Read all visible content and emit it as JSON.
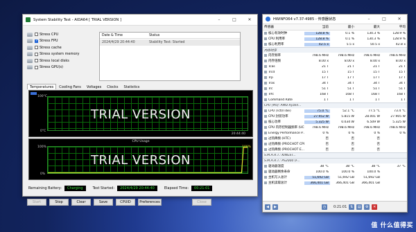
{
  "aida": {
    "title": "System Stability Test - AIDA64  [ TRIAL VERSION ]",
    "stress_options": [
      {
        "label": "Stress CPU",
        "checked": false
      },
      {
        "label": "Stress FPU",
        "checked": true
      },
      {
        "label": "Stress cache",
        "checked": false
      },
      {
        "label": "Stress system memory",
        "checked": false
      },
      {
        "label": "Stress local disks",
        "checked": false
      },
      {
        "label": "Stress GPU(s)",
        "checked": false
      }
    ],
    "log_headers": {
      "date": "Date & Time",
      "status": "Status"
    },
    "log_rows": [
      {
        "date": "2024/4/29 20:44:40",
        "status": "Stability Test: Started"
      }
    ],
    "tabs": [
      "Temperatures",
      "Cooling Fans",
      "Voltages",
      "Clocks",
      "Statistics"
    ],
    "graph1": {
      "top_label": "100°C",
      "bottom_label": "0°C",
      "time_label": "20:44:40",
      "watermark": "TRIAL VERSION"
    },
    "graph2": {
      "title": "CPU Usage",
      "top_label": "100%",
      "bottom_label": "0%",
      "right_label": "100%",
      "watermark": "TRIAL VERSION"
    },
    "status": {
      "battery_label": "Remaining Battery:",
      "battery_value": "Charging",
      "started_label": "Test Started:",
      "started_value": "2024/4/29 20:44:40",
      "elapsed_label": "Elapsed Time:",
      "elapsed_value": "00:21:01"
    },
    "buttons": {
      "start": "Start",
      "stop": "Stop",
      "clear": "Clear",
      "save": "Save",
      "cpuid": "CPUID",
      "preferences": "Preferences",
      "close": "Close"
    }
  },
  "hw": {
    "title": "HWiNFO64 v7.37-4985 - 传感器状态",
    "headers": {
      "sensor": "传感器",
      "current": "当前",
      "min": "最小",
      "max": "最大",
      "avg": "平均"
    },
    "rows": [
      {
        "type": "row",
        "n": "核心有效时钟",
        "c": "128.8 %",
        "mi": "0.1 %",
        "ma": "130.3 %",
        "av": "128.9 %",
        "hl": true
      },
      {
        "type": "row",
        "n": "CPU 利用率",
        "c": "128.8 %",
        "mi": "0.1 %",
        "ma": "130.3 %",
        "av": "128.9 %",
        "hl": true
      },
      {
        "type": "row",
        "n": "核心利用率",
        "c": "42.5 x",
        "mi": "5.5 x",
        "ma": "50.5 x",
        "av": "42.8 x",
        "hl": true
      },
      {
        "type": "group",
        "n": "内存时序"
      },
      {
        "type": "row",
        "n": "内存频率",
        "c": "798.6 MHz",
        "mi": "798.6 MHz",
        "ma": "798.6 MHz",
        "av": "798.6 MHz"
      },
      {
        "type": "row",
        "n": "内存倍频",
        "c": "8.00 x",
        "mi": "8.00 x",
        "ma": "8.00 x",
        "av": "8.00 x"
      },
      {
        "type": "row",
        "n": "Tcas",
        "c": "21 T",
        "mi": "21 T",
        "ma": "21 T",
        "av": "21 T"
      },
      {
        "type": "row",
        "n": "Trcd",
        "c": "15 T",
        "mi": "15 T",
        "ma": "15 T",
        "av": "15 T"
      },
      {
        "type": "row",
        "n": "Trp",
        "c": "17 T",
        "mi": "17 T",
        "ma": "17 T",
        "av": "17 T"
      },
      {
        "type": "row",
        "n": "Tras",
        "c": "34 T",
        "mi": "34 T",
        "ma": "34 T",
        "av": "34 T"
      },
      {
        "type": "row",
        "n": "Trc",
        "c": "51 T",
        "mi": "51 T",
        "ma": "51 T",
        "av": "51 T"
      },
      {
        "type": "row",
        "n": "Trfc",
        "c": "168 T",
        "mi": "168 T",
        "ma": "168 T",
        "av": "168 T"
      },
      {
        "type": "row",
        "n": "Command Rate",
        "c": "1 T",
        "mi": "1 T",
        "ma": "1 T",
        "av": "1 T"
      },
      {
        "type": "group",
        "n": "CPU [#0]: AMD Ryzen..."
      },
      {
        "type": "row",
        "n": "CPU (Tctl/Tdie)",
        "c": "75.0 °C",
        "mi": "52.1 °C",
        "ma": "77.5 °C",
        "av": "73.4 °C",
        "hl": true
      },
      {
        "type": "row",
        "n": "CPU 封装功率",
        "c": "27.952 W",
        "mi": "5.815 W",
        "ma": "28.001 W",
        "av": "27.905 W",
        "hl": true
      },
      {
        "type": "row",
        "n": "核心功率",
        "c": "5.325 W",
        "mi": "0.034 W",
        "ma": "6.509 W",
        "av": "5.325 W",
        "hl": true
      },
      {
        "type": "row",
        "n": "CPU 内存控制器频率 (UCL...",
        "c": "798.6 MHz",
        "mi": "798.6 MHz",
        "ma": "798.6 MHz",
        "av": "798.6 MHz"
      },
      {
        "type": "row",
        "n": "Energy Performance P...",
        "c": "0 %",
        "mi": "0 %",
        "ma": "0 %",
        "av": "0 %"
      },
      {
        "type": "row",
        "n": "过热降频 (HTC)",
        "c": "否",
        "mi": "否",
        "ma": "否",
        "av": ""
      },
      {
        "type": "row",
        "n": "过热降频 (PROCHOT CPU)",
        "c": "否",
        "mi": "否",
        "ma": "否",
        "av": ""
      },
      {
        "type": "row",
        "n": "过热降频 (PROCHOT E...",
        "c": "否",
        "mi": "否",
        "ma": "否",
        "av": ""
      },
      {
        "type": "group",
        "n": "S.M.A.R.T.: KINGST..."
      },
      {
        "type": "group",
        "n": "S.M.A.R.T.: PS2000 (F..."
      },
      {
        "type": "row",
        "n": "驱动器温度",
        "c": "38 °C",
        "mi": "38 °C",
        "ma": "38 °C",
        "av": "37 °C"
      },
      {
        "type": "row",
        "n": "驱动器剩余寿命",
        "c": "100.0 %",
        "mi": "100.0 %",
        "ma": "100.0 %",
        "av": ""
      },
      {
        "type": "row",
        "n": "主机写入总计",
        "c": "51,692 GB",
        "mi": "51,692 GB",
        "ma": "51,692 GB",
        "av": "",
        "hl": true
      },
      {
        "type": "row",
        "n": "主机读取总计",
        "c": "366,401 GB",
        "mi": "366,401 GB",
        "ma": "366,401 GB",
        "av": "",
        "hl": true
      }
    ],
    "clock": "0:21:01"
  },
  "brand": "值 什么值得买"
}
